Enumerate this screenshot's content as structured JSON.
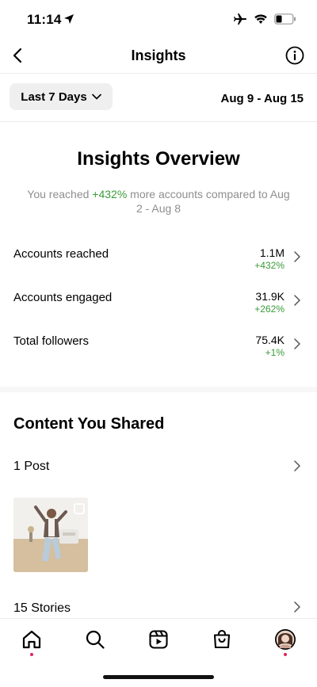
{
  "status_bar": {
    "time": "11:14"
  },
  "nav": {
    "title": "Insights"
  },
  "filter": {
    "range_label": "Last 7 Days",
    "dates": "Aug 9 - Aug 15"
  },
  "overview": {
    "title": "Insights Overview",
    "sub_before": "You reached ",
    "sub_highlight": "+432%",
    "sub_after": " more accounts compared to Aug 2 - Aug 8",
    "accent_color": "#3a9a3a"
  },
  "metrics": [
    {
      "label": "Accounts reached",
      "value": "1.1M",
      "delta": "+432%"
    },
    {
      "label": "Accounts engaged",
      "value": "31.9K",
      "delta": "+262%"
    },
    {
      "label": "Total followers",
      "value": "75.4K",
      "delta": "+1%"
    }
  ],
  "content": {
    "title": "Content You Shared",
    "posts_label": "1 Post",
    "stories_label": "15 Stories"
  },
  "tabs": [
    "home-icon",
    "search-icon",
    "reels-icon",
    "shop-icon",
    "profile-avatar"
  ]
}
